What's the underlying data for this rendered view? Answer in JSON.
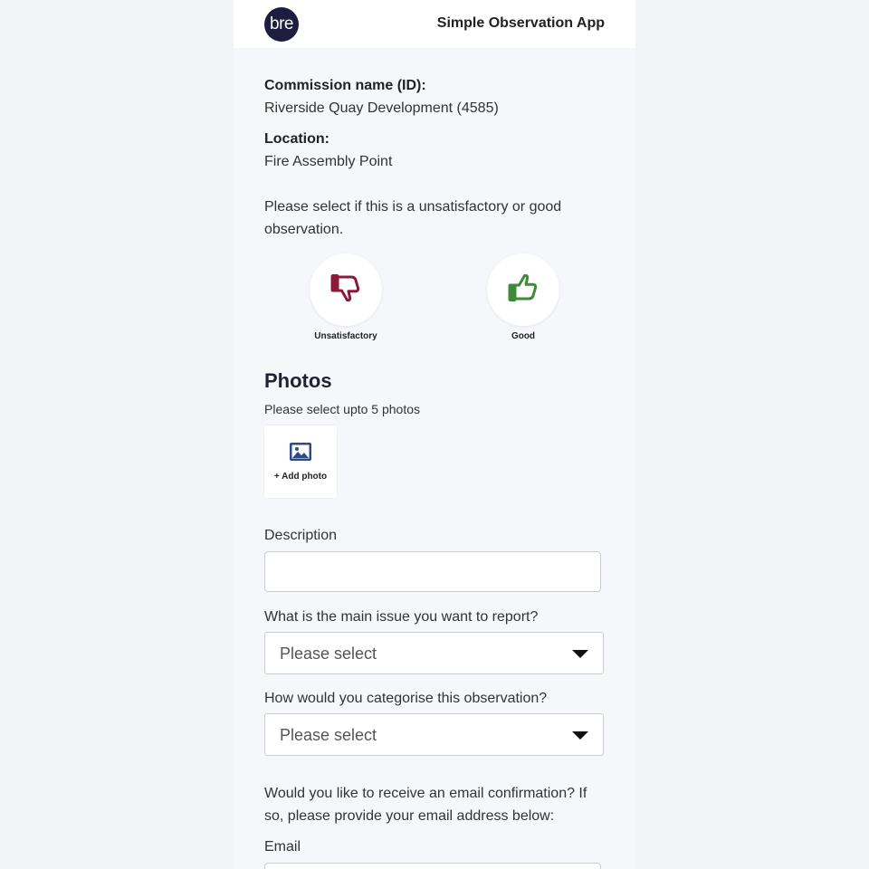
{
  "header": {
    "logo_text": "bre",
    "title": "Simple Observation App"
  },
  "commission": {
    "label": "Commission name (ID):",
    "value": "Riverside Quay Development (4585)"
  },
  "location": {
    "label": "Location:",
    "value": "Fire Assembly Point"
  },
  "observation": {
    "prompt": "Please select if this is a unsatisfactory or good observation.",
    "unsatisfactory_label": "Unsatisfactory",
    "good_label": "Good",
    "unsatisfactory_color": "#8b1a3a",
    "good_color": "#3e8a3a"
  },
  "photos": {
    "heading": "Photos",
    "subtext": "Please select upto 5 photos",
    "add_label": "+ Add photo",
    "icon_color": "#2f4a8a"
  },
  "description": {
    "label": "Description",
    "value": ""
  },
  "main_issue": {
    "label": "What is the main issue you want to report?",
    "selected": "Please select"
  },
  "category": {
    "label": "How would you categorise this observation?",
    "selected": "Please select"
  },
  "email_confirm": {
    "prompt": "Would you like to receive an email confirmation? If so, please provide your email address below:"
  },
  "email": {
    "label": "Email",
    "value": ""
  }
}
